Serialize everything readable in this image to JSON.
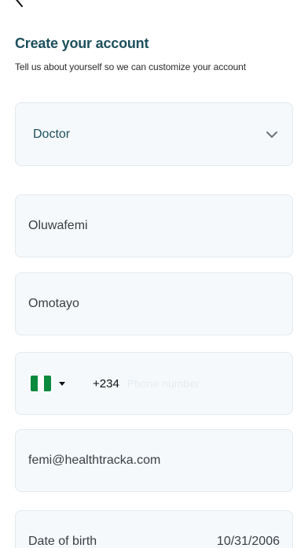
{
  "header": {
    "title": "Create your account",
    "subtitle": "Tell us about yourself so we can customize your account"
  },
  "role": {
    "selected": "Doctor"
  },
  "form": {
    "first_name": "Oluwafemi",
    "last_name": "Omotayo",
    "phone": {
      "country": "Nigeria",
      "dial_code": "+234",
      "placeholder": "Phone number"
    },
    "email": "femi@healthtracka.com",
    "dob": {
      "label": "Date of birth",
      "value": "10/31/2006"
    }
  },
  "colors": {
    "title": "#1d4f5c",
    "field_bg": "#f6f9fb",
    "field_border": "#e3e9ee",
    "flag_green": "#0b8a3e"
  }
}
